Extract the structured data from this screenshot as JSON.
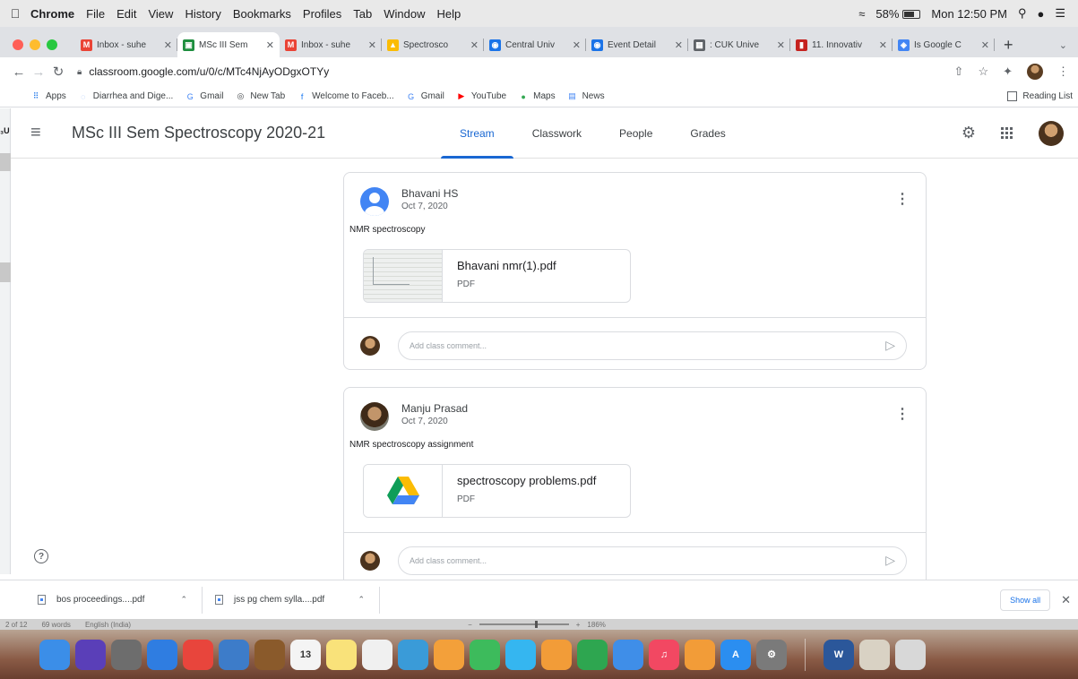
{
  "menubar": {
    "app": "Chrome",
    "items": [
      "File",
      "Edit",
      "View",
      "History",
      "Bookmarks",
      "Profiles",
      "Tab",
      "Window",
      "Help"
    ],
    "battery": "58%",
    "clock": "Mon 12:50 PM"
  },
  "tabs": [
    {
      "title": "Inbox - suhe",
      "icon": "gmail-icon",
      "color": "#ea4335",
      "glyph": "M",
      "active": false
    },
    {
      "title": "MSc III Sem",
      "icon": "classroom-icon",
      "color": "#1e8e3e",
      "glyph": "▣",
      "active": true
    },
    {
      "title": "Inbox - suhe",
      "icon": "gmail-icon",
      "color": "#ea4335",
      "glyph": "M",
      "active": false
    },
    {
      "title": "Spectrosco",
      "icon": "drive-icon",
      "color": "#fbbc04",
      "glyph": "▲",
      "active": false
    },
    {
      "title": "Central Univ",
      "icon": "university-icon",
      "color": "#1a73e8",
      "glyph": "◉",
      "active": false
    },
    {
      "title": "Event Detail",
      "icon": "university-icon",
      "color": "#1a73e8",
      "glyph": "◉",
      "active": false
    },
    {
      "title": ": CUK Unive",
      "icon": "slides-icon",
      "color": "#5f6368",
      "glyph": "▦",
      "active": false
    },
    {
      "title": "11. Innovativ",
      "icon": "page-icon",
      "color": "#c5221f",
      "glyph": "▮",
      "active": false
    },
    {
      "title": "Is Google C",
      "icon": "google-icon",
      "color": "#4285f4",
      "glyph": "◈",
      "active": false
    }
  ],
  "address": {
    "url": "classroom.google.com/u/0/c/MTc4NjAyODgxOTYy"
  },
  "bookmarks": [
    {
      "label": "Apps",
      "icon": "apps-grid-icon",
      "glyph": "⠿",
      "color": "#1a73e8"
    },
    {
      "label": "Diarrhea and Dige...",
      "icon": "site-icon",
      "glyph": "◌",
      "color": "#8ab4f8"
    },
    {
      "label": "Gmail",
      "icon": "google-g-icon",
      "glyph": "G",
      "color": "#4285f4"
    },
    {
      "label": "New Tab",
      "icon": "chrome-icon",
      "glyph": "◎",
      "color": "#3c4043"
    },
    {
      "label": "Welcome to Faceb...",
      "icon": "facebook-icon",
      "glyph": "f",
      "color": "#1877f2"
    },
    {
      "label": "Gmail",
      "icon": "google-g-icon",
      "glyph": "G",
      "color": "#4285f4"
    },
    {
      "label": "YouTube",
      "icon": "youtube-icon",
      "glyph": "▶",
      "color": "#ff0000"
    },
    {
      "label": "Maps",
      "icon": "maps-pin-icon",
      "glyph": "●",
      "color": "#34a853"
    },
    {
      "label": "News",
      "icon": "news-icon",
      "glyph": "▤",
      "color": "#4285f4"
    }
  ],
  "reading_list": "Reading List",
  "classroom": {
    "title": "MSc III Sem Spectroscopy 2020-21",
    "tabs": [
      "Stream",
      "Classwork",
      "People",
      "Grades"
    ],
    "active_tab": "Stream"
  },
  "posts": [
    {
      "author": "Bhavani HS",
      "date": "Oct 7, 2020",
      "text": "NMR spectroscopy",
      "attachment": {
        "name": "Bhavani nmr(1).pdf",
        "type": "PDF"
      },
      "comment_placeholder": "Add class comment..."
    },
    {
      "author": "Manju Prasad",
      "date": "Oct 7, 2020",
      "text": "NMR spectroscopy assignment",
      "attachment": {
        "name": "spectroscopy problems.pdf",
        "type": "PDF"
      },
      "comment_placeholder": "Add class comment..."
    }
  ],
  "downloads": [
    {
      "name": "bos proceedings....pdf"
    },
    {
      "name": "jss pg chem sylla....pdf"
    }
  ],
  "show_all": "Show all",
  "wordbar": {
    "page": "2 of 12",
    "words": "69 words",
    "language": "English (India)",
    "zoom": "186%"
  },
  "dock": [
    {
      "name": "finder-icon",
      "color": "#3b8ee8",
      "glyph": ""
    },
    {
      "name": "siri-icon",
      "color": "#5a3fb8",
      "glyph": ""
    },
    {
      "name": "launchpad-icon",
      "color": "#6d6d6d",
      "glyph": ""
    },
    {
      "name": "safari-icon",
      "color": "#2f7de1",
      "glyph": ""
    },
    {
      "name": "chrome-dock-icon",
      "color": "#e8453c",
      "glyph": ""
    },
    {
      "name": "preview-icon",
      "color": "#3d7cc9",
      "glyph": ""
    },
    {
      "name": "notebook-icon",
      "color": "#8a5a2b",
      "glyph": ""
    },
    {
      "name": "calendar-icon",
      "color": "#f4f4f4",
      "glyph": "13"
    },
    {
      "name": "notes-icon",
      "color": "#f9e27a",
      "glyph": ""
    },
    {
      "name": "reminders-icon",
      "color": "#f0f0f0",
      "glyph": ""
    },
    {
      "name": "photos-icon",
      "color": "#3a9bd8",
      "glyph": ""
    },
    {
      "name": "photos-flower-icon",
      "color": "#f3a03a",
      "glyph": ""
    },
    {
      "name": "facetime-icon",
      "color": "#3dbb5c",
      "glyph": ""
    },
    {
      "name": "messages-icon",
      "color": "#35b6f0",
      "glyph": ""
    },
    {
      "name": "pages-icon",
      "color": "#f29c38",
      "glyph": ""
    },
    {
      "name": "numbers-icon",
      "color": "#2ea650",
      "glyph": ""
    },
    {
      "name": "keynote-icon",
      "color": "#3f8ee8",
      "glyph": ""
    },
    {
      "name": "music-icon",
      "color": "#f24862",
      "glyph": "♫"
    },
    {
      "name": "books-icon",
      "color": "#f29c38",
      "glyph": ""
    },
    {
      "name": "app-store-icon",
      "color": "#2b8ef0",
      "glyph": "A"
    },
    {
      "name": "system-preferences-icon",
      "color": "#7a7a7a",
      "glyph": "⚙"
    },
    {
      "name": "word-icon",
      "color": "#2b579a",
      "glyph": "W"
    },
    {
      "name": "photo-thumbnail-icon",
      "color": "#d9d2c4",
      "glyph": ""
    },
    {
      "name": "trash-icon",
      "color": "#d8d8d8",
      "glyph": ""
    }
  ],
  "colors": {
    "accent": "#1967d2",
    "border": "#dadce0"
  }
}
